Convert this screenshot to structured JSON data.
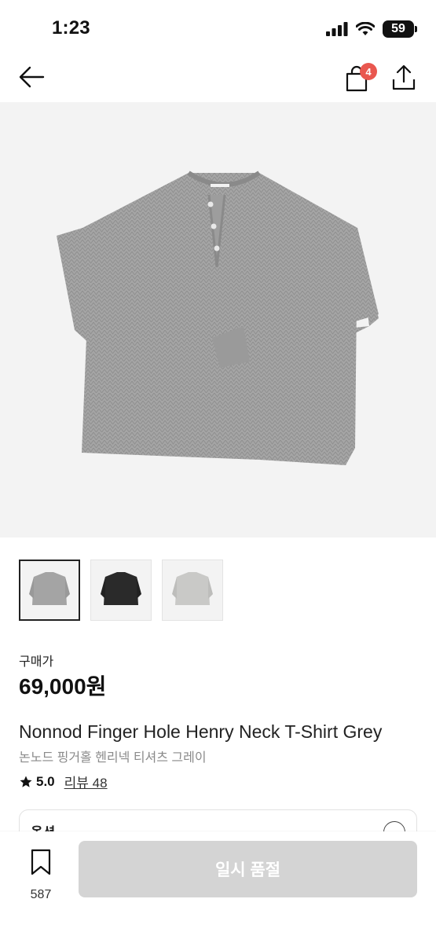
{
  "status_bar": {
    "time": "1:23",
    "battery": "59"
  },
  "nav": {
    "cart_count": "4"
  },
  "thumbnails": [
    {
      "color": "#a4a4a4"
    },
    {
      "color": "#2a2a2a"
    },
    {
      "color": "#c9c9c7"
    }
  ],
  "product": {
    "price_label": "구매가",
    "price": "69,000원",
    "title_en": "Nonnod Finger Hole Henry Neck T-Shirt Grey",
    "title_ko": "논노드 핑거홀 헨리넥 티셔츠 그레이",
    "rating": "5.0",
    "reviews": "리뷰 48"
  },
  "option": {
    "label": "옵션"
  },
  "bottom": {
    "bookmark_count": "587",
    "button_label": "일시 품절"
  },
  "colors": {
    "badge": "#e9574f",
    "disabled_button": "#d4d4d4",
    "hero_bg": "#f3f3f3"
  }
}
